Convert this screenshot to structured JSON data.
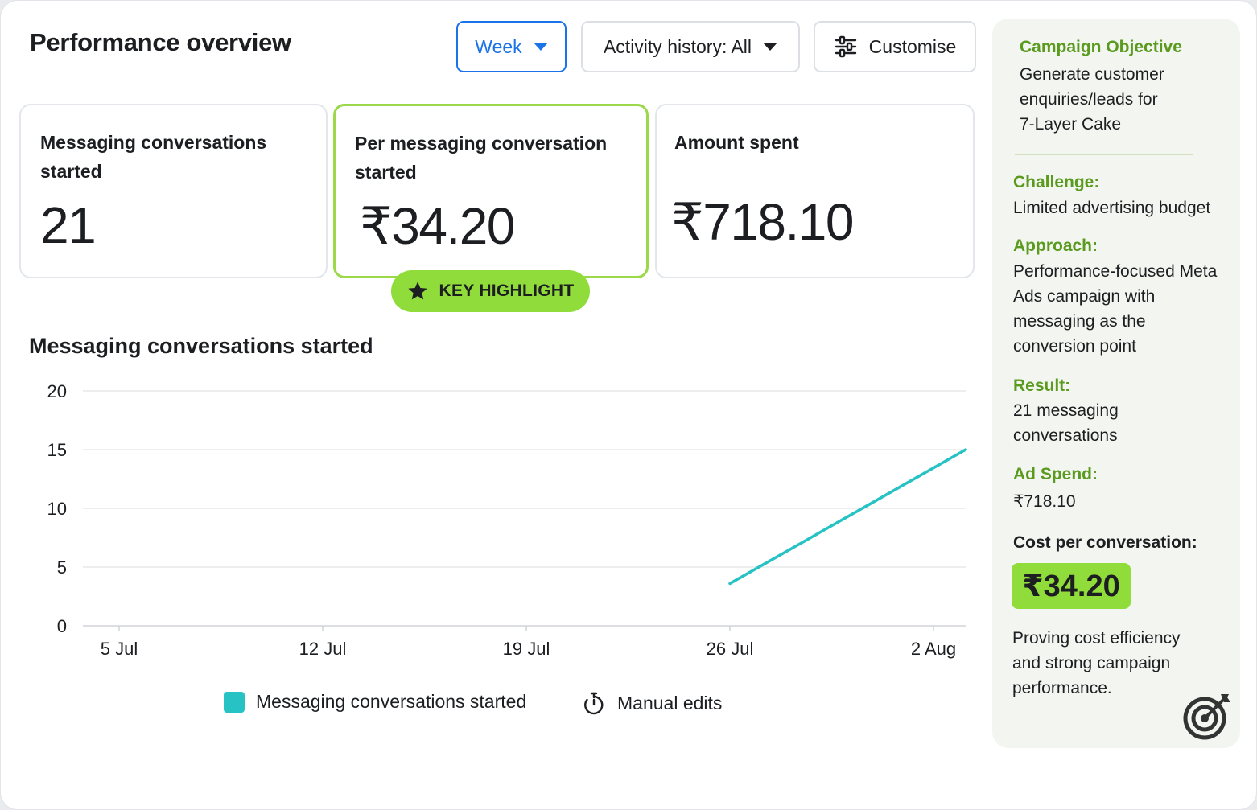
{
  "header": {
    "title": "Performance overview",
    "week_label": "Week",
    "activity_label": "Activity history: All",
    "customise_label": "Customise"
  },
  "cards": [
    {
      "label": "Messaging conversations started",
      "value": "21"
    },
    {
      "label": "Per messaging conversation started",
      "value": "₹34.20"
    },
    {
      "label": "Amount spent",
      "value": "₹718.10"
    }
  ],
  "badge": {
    "label": "KEY HIGHLIGHT"
  },
  "chart": {
    "title": "Messaging conversations started"
  },
  "legend": {
    "series_label": "Messaging conversations started",
    "manual_label": "Manual edits"
  },
  "side_panel": {
    "objective_heading": "Campaign Objective",
    "objective_lines": [
      "Generate customer",
      "enquiries/leads for",
      "7-Layer Cake"
    ],
    "challenge_heading": "Challenge:",
    "challenge_text": "Limited advertising budget",
    "approach_heading": "Approach:",
    "approach_lines": [
      "Performance-focused Meta",
      "Ads campaign with",
      "messaging as the",
      "conversion point"
    ],
    "result_heading": "Result:",
    "result_lines": [
      "21 messaging",
      "conversations"
    ],
    "spend_heading": "Ad Spend:",
    "spend_value": "₹718.10",
    "cost_heading": "Cost per conversation:",
    "cost_value": "₹34.20",
    "closing_lines": [
      "Proving cost efficiency",
      "and strong campaign",
      "performance."
    ]
  },
  "colors": {
    "accent_blue": "#1a73e8",
    "highlight_green": "#8fdc3a",
    "heading_green": "#5a9a1e",
    "series_teal": "#26c2c4"
  },
  "icons": [
    "caret-down-icon",
    "sliders-icon",
    "star-icon",
    "stopwatch-icon",
    "target-icon"
  ],
  "chart_data": {
    "type": "line",
    "title": "Messaging conversations started",
    "categories": [
      "5 Jul",
      "12 Jul",
      "19 Jul",
      "26 Jul",
      "2 Aug"
    ],
    "yticks": [
      0,
      5,
      10,
      15,
      20
    ],
    "ylim": [
      0,
      20
    ],
    "grid": true,
    "legend_position": "bottom",
    "series": [
      {
        "name": "Messaging conversations started",
        "color": "#26c2c4",
        "points": [
          {
            "x": "26 Jul",
            "y": 3.6
          },
          {
            "x": "2 Aug",
            "y": 15
          }
        ]
      }
    ]
  }
}
